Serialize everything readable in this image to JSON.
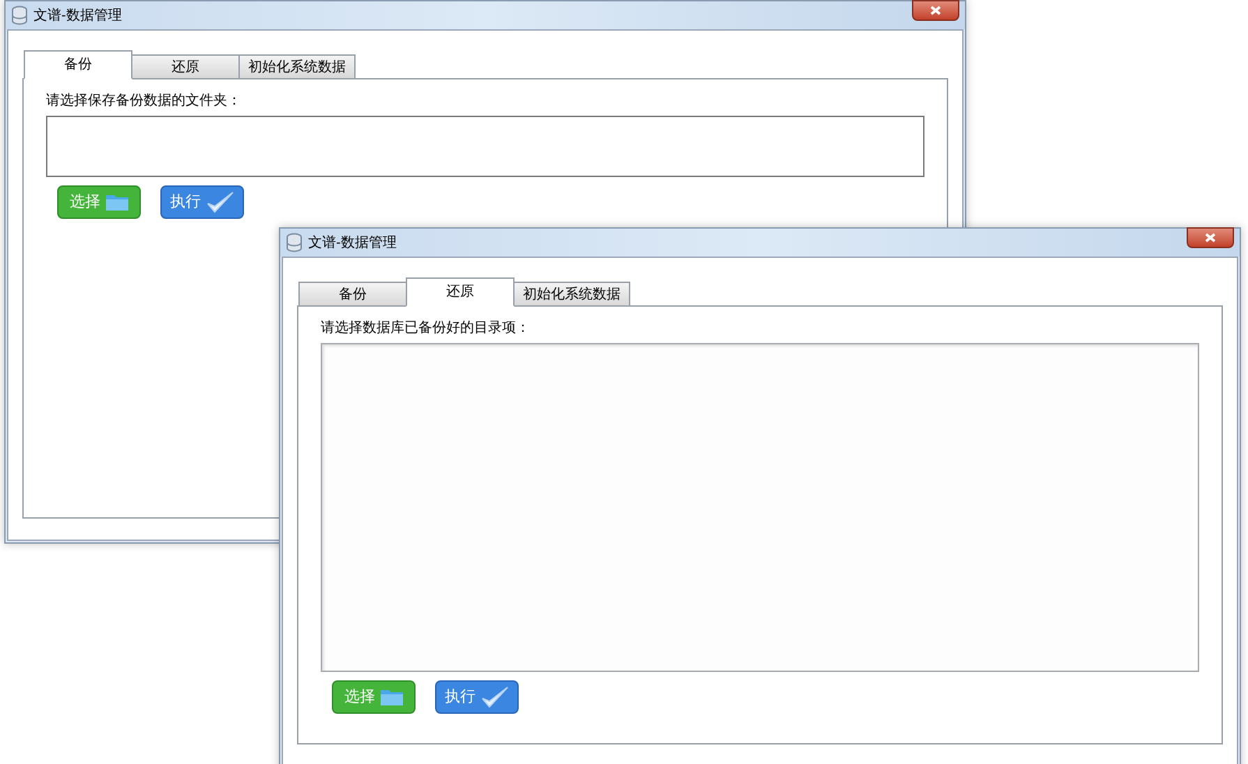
{
  "windows": [
    {
      "title": "文谱-数据管理",
      "tabs": [
        {
          "label": "备份",
          "selected": true
        },
        {
          "label": "还原",
          "selected": false
        },
        {
          "label": "初始化系统数据",
          "selected": false
        }
      ],
      "prompt": "请选择保存备份数据的文件夹：",
      "kind": "textbox",
      "buttons": [
        {
          "label": "选择",
          "kind": "select"
        },
        {
          "label": "执行",
          "kind": "run"
        }
      ]
    },
    {
      "title": "文谱-数据管理",
      "tabs": [
        {
          "label": "备份",
          "selected": false
        },
        {
          "label": "还原",
          "selected": true
        },
        {
          "label": "初始化系统数据",
          "selected": false
        }
      ],
      "prompt": "请选择数据库已备份好的目录项：",
      "kind": "listbox",
      "buttons": [
        {
          "label": "选择",
          "kind": "select"
        },
        {
          "label": "执行",
          "kind": "run"
        }
      ]
    }
  ]
}
